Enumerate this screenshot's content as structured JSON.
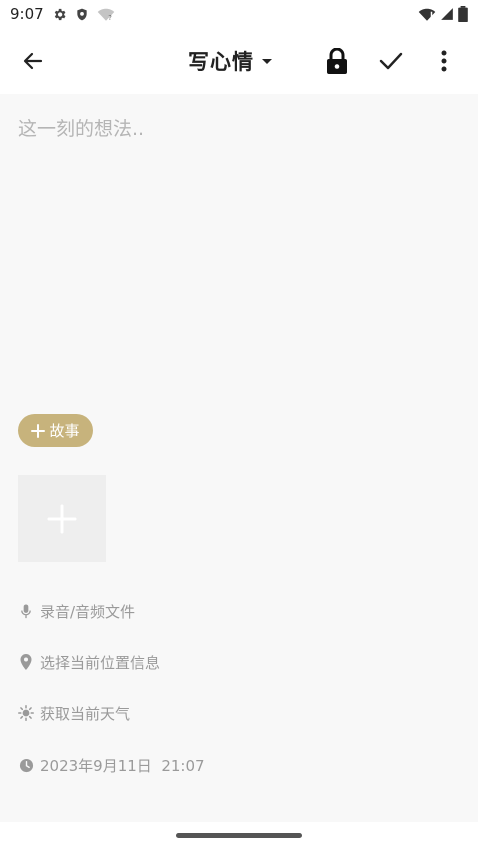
{
  "status_bar": {
    "time": "9:07",
    "icons": [
      "settings-icon",
      "shield-icon",
      "wifi-unknown-icon",
      "wifi-icon",
      "signal-icon",
      "battery-icon"
    ]
  },
  "app_bar": {
    "title": "写心情",
    "icons": [
      "back-arrow-icon",
      "dropdown-caret-icon",
      "lock-icon",
      "check-icon",
      "more-vert-icon"
    ]
  },
  "editor": {
    "placeholder": "这一刻的想法.."
  },
  "story_chip": {
    "label": "故事",
    "icon": "plus-icon",
    "color": "#c7b37c"
  },
  "add_media": {
    "icon": "plus-icon"
  },
  "meta": {
    "audio_label": "录音/音频文件",
    "location_label": "选择当前位置信息",
    "weather_label": "获取当前天气",
    "date_label": "2023年9月11日  21:07"
  },
  "colors": {
    "accent": "#c7b37c",
    "background": "#f8f8f8",
    "muted_text": "#9a9a9a"
  }
}
